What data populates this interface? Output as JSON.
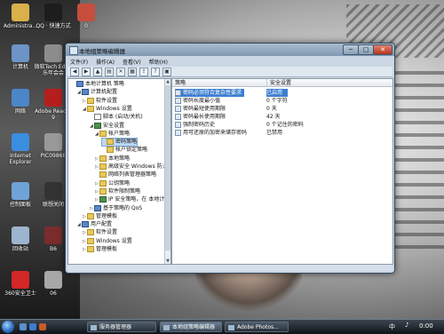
{
  "desktop": {
    "icons": [
      {
        "label": "Administra...",
        "icon": "user-folder-icon",
        "color": "#d9b04c"
      },
      {
        "label": "QQ · 快速方式",
        "icon": "qq-penguin-icon",
        "color": "#1d1d1d"
      },
      {
        "label": "0",
        "icon": "image-icon",
        "color": "#c74e3d"
      },
      {
        "label": "计算机",
        "icon": "computer-icon",
        "color": "#6e93c7"
      },
      {
        "label": "微软Tech Ed 乘乐年会会",
        "icon": "media-icon",
        "color": "#8d8d8d"
      },
      {
        "label": "网络",
        "icon": "network-icon",
        "color": "#4a86c8"
      },
      {
        "label": "Adobe Reader 9",
        "icon": "adobe-reader-icon",
        "color": "#b61e1e"
      },
      {
        "label": "Internet Explorer",
        "icon": "ie-icon",
        "color": "#3b8de0"
      },
      {
        "label": "PIC09868",
        "icon": "picture-icon",
        "color": "#999999"
      },
      {
        "label": "控制面板",
        "icon": "control-panel-icon",
        "color": "#6fa3d8"
      },
      {
        "label": "联想关闭",
        "icon": "shortcut-icon",
        "color": "#333333"
      },
      {
        "label": "回收站",
        "icon": "recycle-bin-icon",
        "color": "#9db4cf"
      },
      {
        "label": "B6",
        "icon": "image-icon",
        "color": "#7a2c2c"
      },
      {
        "label": "360安全卫士",
        "icon": "security-guard-icon",
        "color": "#d42727"
      },
      {
        "label": "06",
        "icon": "image-icon",
        "color": "#a7a7a7"
      }
    ]
  },
  "window": {
    "title": "本地组策略编辑器",
    "buttons": {
      "minimize": "─",
      "maximize": "□",
      "close": "✕"
    },
    "menu": [
      "文件(F)",
      "操作(A)",
      "查看(V)",
      "帮助(H)"
    ],
    "toolbar": [
      "back-icon",
      "forward-icon",
      "up-folder-icon",
      "show-hide-tree-icon",
      "delete-icon",
      "properties-icon",
      "export-icon",
      "help-icon",
      "view-icon"
    ],
    "tree": [
      {
        "label": "本地计算机 策略",
        "icon": "comp",
        "toggle": "",
        "sel": false
      },
      {
        "label": "计算机配置",
        "icon": "comp",
        "toggle": "◢",
        "sel": false
      },
      {
        "label": "软件设置",
        "icon": "folder",
        "toggle": "▷",
        "sel": false
      },
      {
        "label": "Windows 设置",
        "icon": "folder",
        "toggle": "◢",
        "sel": false
      },
      {
        "label": "脚本 (启动/关机)",
        "icon": "doc",
        "toggle": "",
        "sel": false
      },
      {
        "label": "安全设置",
        "icon": "shield",
        "toggle": "◢",
        "sel": false
      },
      {
        "label": "帐户策略",
        "icon": "folder",
        "toggle": "◢",
        "sel": false
      },
      {
        "label": "密码策略",
        "icon": "folder",
        "toggle": "",
        "sel": true
      },
      {
        "label": "帐户锁定策略",
        "icon": "folder",
        "toggle": "",
        "sel": false
      },
      {
        "label": "本地策略",
        "icon": "folder",
        "toggle": "▷",
        "sel": false
      },
      {
        "label": "高级安全 Windows 防火墙",
        "icon": "folder",
        "toggle": "▷",
        "sel": false
      },
      {
        "label": "网络列表管理器策略",
        "icon": "folder",
        "toggle": "",
        "sel": false
      },
      {
        "label": "公钥策略",
        "icon": "folder",
        "toggle": "▷",
        "sel": false
      },
      {
        "label": "软件限制策略",
        "icon": "folder",
        "toggle": "▷",
        "sel": false
      },
      {
        "label": "IP 安全策略，在 本地计算机",
        "icon": "shield",
        "toggle": "▷",
        "sel": false
      },
      {
        "label": "基于策略的 QoS",
        "icon": "comp",
        "toggle": "▷",
        "sel": false
      },
      {
        "label": "管理模板",
        "icon": "folder",
        "toggle": "▷",
        "sel": false
      },
      {
        "label": "用户配置",
        "icon": "comp",
        "toggle": "◢",
        "sel": false
      },
      {
        "label": "软件设置",
        "icon": "folder",
        "toggle": "▷",
        "sel": false
      },
      {
        "label": "Windows 设置",
        "icon": "folder",
        "toggle": "▷",
        "sel": false
      },
      {
        "label": "管理模板",
        "icon": "folder",
        "toggle": "▷",
        "sel": false
      }
    ],
    "columns": {
      "policy": "策略",
      "setting": "安全设置"
    },
    "rows": [
      {
        "policy": "密码必须符合复杂性要求",
        "setting": "已启用",
        "sel": true
      },
      {
        "policy": "密码长度最小值",
        "setting": "0 个字符",
        "sel": false
      },
      {
        "policy": "密码最短使用期限",
        "setting": "0 天",
        "sel": false
      },
      {
        "policy": "密码最长使用期限",
        "setting": "42 天",
        "sel": false
      },
      {
        "policy": "强制密码历史",
        "setting": "0 个记住的密码",
        "sel": false
      },
      {
        "policy": "用可还原的加密来储存密码",
        "setting": "已禁用",
        "sel": false
      }
    ]
  },
  "taskbar": {
    "tasks": [
      {
        "label": "服务器管理器",
        "active": false
      },
      {
        "label": "本地组策略编辑器",
        "active": true
      },
      {
        "label": "Adobe Photos...",
        "active": false
      }
    ],
    "language": "中",
    "clock": "0:00"
  }
}
